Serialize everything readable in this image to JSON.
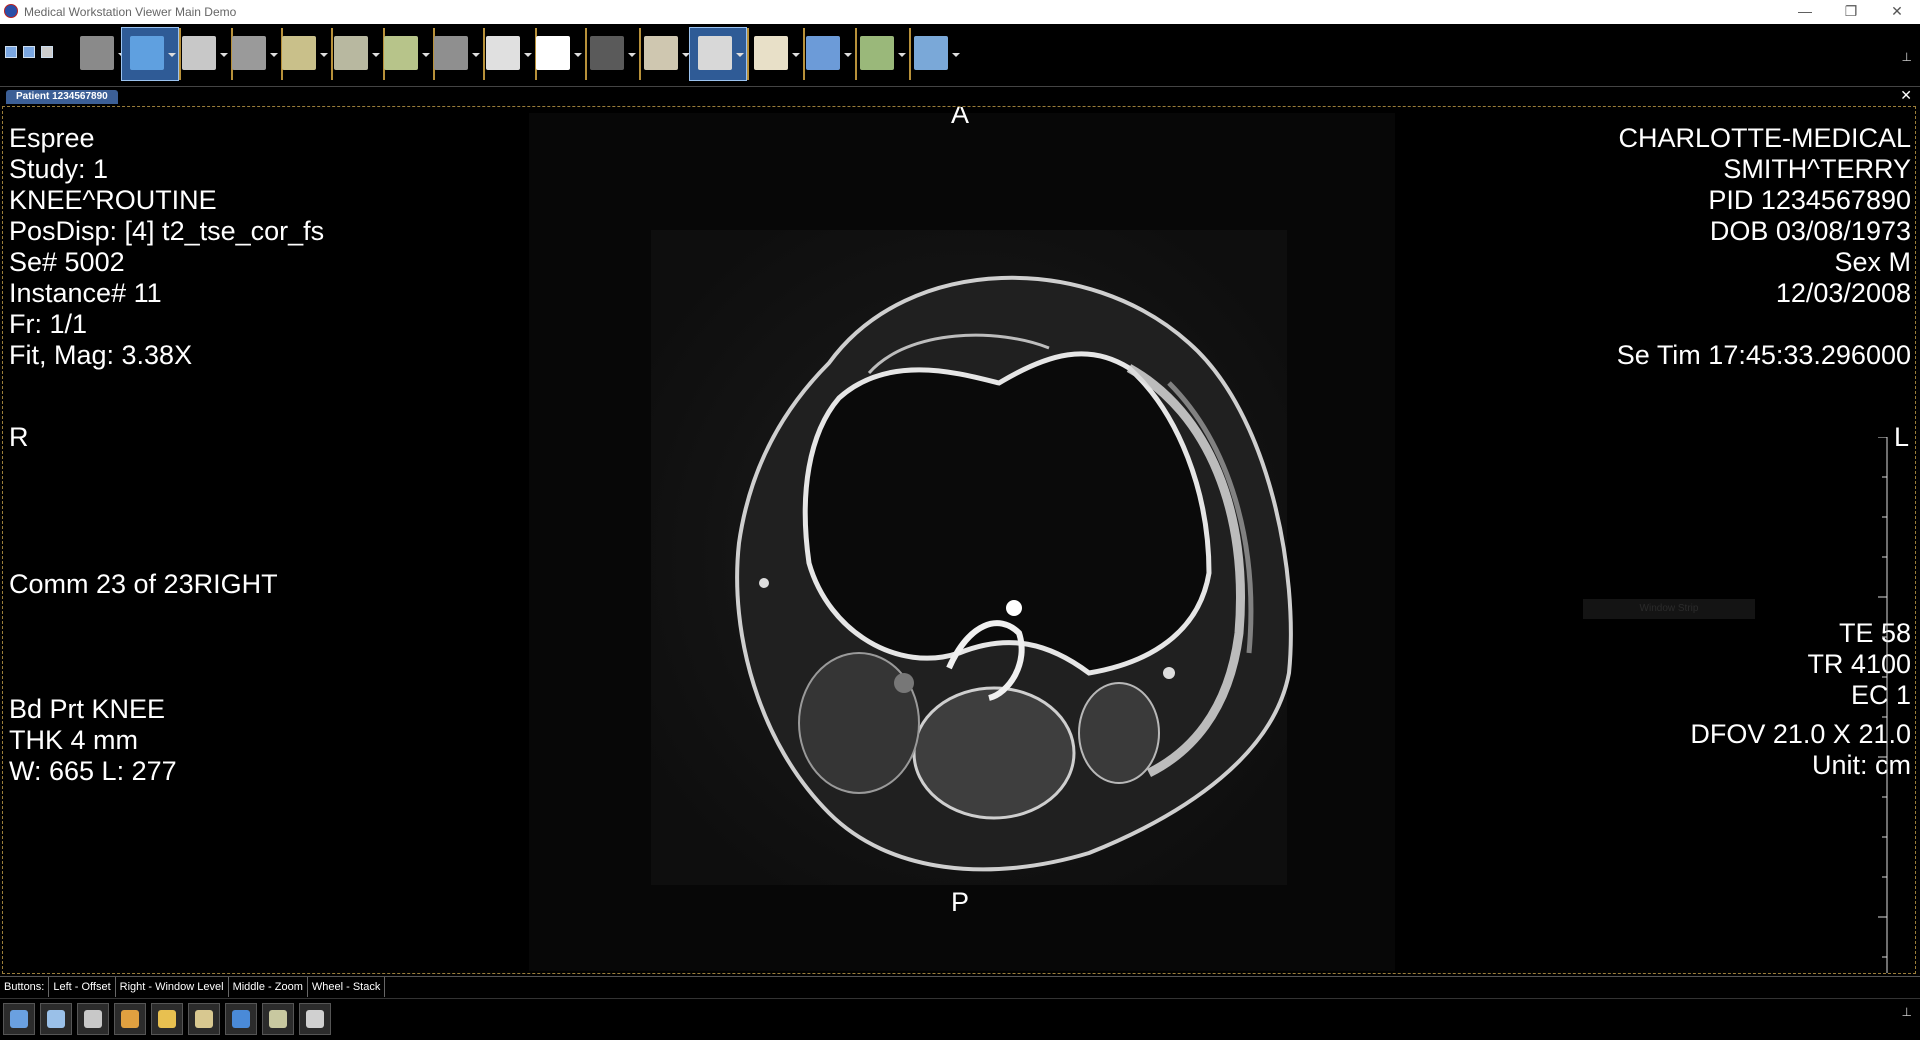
{
  "window": {
    "title": "Medical Workstation Viewer Main Demo",
    "minimize_glyph": "—",
    "restore_glyph": "❐",
    "close_glyph": "✕"
  },
  "toolbar": {
    "buttons": [
      {
        "name": "stack-icon",
        "color": "#8a8a8a"
      },
      {
        "name": "pan-icon",
        "color": "#5fa0e0",
        "active": true
      },
      {
        "name": "magnify-icon",
        "color": "#c8c8c8"
      },
      {
        "name": "window-level-icon",
        "color": "#9a9a9a"
      },
      {
        "name": "roi-icon",
        "color": "#c9c08a"
      },
      {
        "name": "ruler-icon",
        "color": "#b8b8a0"
      },
      {
        "name": "angle-icon",
        "color": "#b7c48a"
      },
      {
        "name": "layout-icon",
        "color": "#8f8f8f"
      },
      {
        "name": "contrast-icon",
        "color": "#e0e0e0"
      },
      {
        "name": "invert-icon",
        "color": "#ffffff"
      },
      {
        "name": "cine-icon",
        "color": "#5a5a5a"
      },
      {
        "name": "export-icon",
        "color": "#cfc7b0"
      },
      {
        "name": "link-icon",
        "color": "#d8d8d8",
        "active": true
      },
      {
        "name": "dicom-info-icon",
        "color": "#e8e0c8"
      },
      {
        "name": "grid-icon",
        "color": "#6c9bd8"
      },
      {
        "name": "picture-icon",
        "color": "#9ab87a"
      },
      {
        "name": "series-layout-icon",
        "color": "#7aa8d8"
      }
    ],
    "pin_glyph": "⊥"
  },
  "tab": {
    "label": "Patient 1234567890",
    "close_glyph": "✕"
  },
  "overlay": {
    "left_top": [
      "Espree",
      "Study: 1",
      "KNEE^ROUTINE",
      "PosDisp: [4] t2_tse_cor_fs",
      "Se# 5002",
      "Instance# 11",
      "Fr: 1/1",
      "Fit, Mag: 3.38X"
    ],
    "left_middle": "Comm 23 of 23RIGHT",
    "left_bottom": [
      "Bd Prt KNEE",
      "THK 4 mm",
      "W: 665 L: 277"
    ],
    "right_top": [
      "CHARLOTTE-MEDICAL",
      "SMITH^TERRY",
      "PID 1234567890",
      "DOB 03/08/1973",
      "Sex M",
      "12/03/2008",
      "",
      "Se Tim 17:45:33.296000"
    ],
    "right_middle": [
      "TE 58",
      "TR 4100",
      "EC 1"
    ],
    "right_bottom": [
      "DFOV 21.0 X 21.0",
      "Unit:  cm"
    ],
    "orient_top": "A",
    "orient_bottom": "P",
    "orient_left": "R",
    "orient_right": "L",
    "window_strip": "Window Strip"
  },
  "statusbar": {
    "items": [
      "Buttons:",
      "Left -  Offset",
      "Right -  Window Level",
      "Middle -  Zoom",
      "Wheel -  Stack"
    ]
  },
  "bottombar": {
    "buttons": [
      {
        "name": "patient-search-icon",
        "color": "#6aa0e0"
      },
      {
        "name": "zoom-search-icon",
        "color": "#9ac0e8"
      },
      {
        "name": "pencil-icon",
        "color": "#c8c8c8"
      },
      {
        "name": "users-icon",
        "color": "#e0a040"
      },
      {
        "name": "settings-icon",
        "color": "#e8c050"
      },
      {
        "name": "eraser-icon",
        "color": "#d8c890"
      },
      {
        "name": "forward-arrow-icon",
        "color": "#4a8ad8"
      },
      {
        "name": "pointer-icon",
        "color": "#c8c8a0"
      },
      {
        "name": "refresh-icon",
        "color": "#d0d0d0"
      }
    ],
    "pin_glyph": "⊥"
  }
}
